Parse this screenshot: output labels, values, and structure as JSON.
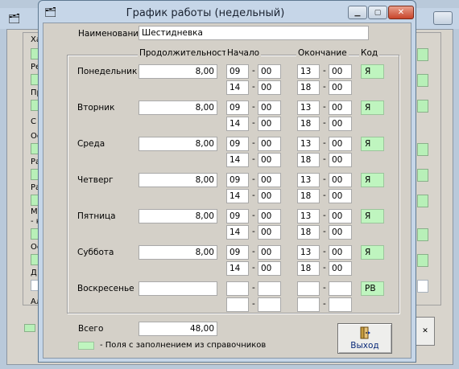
{
  "window": {
    "title": "График работы (недельный)",
    "controls": {
      "minimize": "▁",
      "maximize": "▢",
      "close": "✕"
    }
  },
  "name_field": {
    "label": "Наименование",
    "value": "Шестидневка"
  },
  "headers": {
    "duration": "Продолжительность",
    "start": "Начало",
    "end": "Окончание",
    "code": "Код"
  },
  "days": [
    {
      "label": "Понедельник",
      "duration": "8,00",
      "start1_h": "09",
      "start1_m": "00",
      "end1_h": "13",
      "end1_m": "00",
      "start2_h": "14",
      "start2_m": "00",
      "end2_h": "18",
      "end2_m": "00",
      "code": "Я"
    },
    {
      "label": "Вторник",
      "duration": "8,00",
      "start1_h": "09",
      "start1_m": "00",
      "end1_h": "13",
      "end1_m": "00",
      "start2_h": "14",
      "start2_m": "00",
      "end2_h": "18",
      "end2_m": "00",
      "code": "Я"
    },
    {
      "label": "Среда",
      "duration": "8,00",
      "start1_h": "09",
      "start1_m": "00",
      "end1_h": "13",
      "end1_m": "00",
      "start2_h": "14",
      "start2_m": "00",
      "end2_h": "18",
      "end2_m": "00",
      "code": "Я"
    },
    {
      "label": "Четверг",
      "duration": "8,00",
      "start1_h": "09",
      "start1_m": "00",
      "end1_h": "13",
      "end1_m": "00",
      "start2_h": "14",
      "start2_m": "00",
      "end2_h": "18",
      "end2_m": "00",
      "code": "Я"
    },
    {
      "label": "Пятница",
      "duration": "8,00",
      "start1_h": "09",
      "start1_m": "00",
      "end1_h": "13",
      "end1_m": "00",
      "start2_h": "14",
      "start2_m": "00",
      "end2_h": "18",
      "end2_m": "00",
      "code": "Я"
    },
    {
      "label": "Суббота",
      "duration": "8,00",
      "start1_h": "09",
      "start1_m": "00",
      "end1_h": "13",
      "end1_m": "00",
      "start2_h": "14",
      "start2_m": "00",
      "end2_h": "18",
      "end2_m": "00",
      "code": "Я"
    },
    {
      "label": "Воскресенье",
      "duration": "",
      "start1_h": "",
      "start1_m": "",
      "end1_h": "",
      "end1_m": "",
      "start2_h": "",
      "start2_m": "",
      "end2_h": "",
      "end2_m": "",
      "code": "РВ"
    }
  ],
  "dash": "-",
  "total": {
    "label": "Всего",
    "value": "48,00"
  },
  "legend": {
    "text": "- Поля с заполнением из справочников"
  },
  "exit_button": {
    "label": "Выход"
  },
  "background_window": {
    "labels": [
      "Ха",
      "Ре",
      "Пр",
      "С",
      "Ос",
      "Ра",
      "Ра",
      "М",
      "- н",
      "Ос",
      "Д",
      "Ал"
    ]
  },
  "colors": {
    "lookup_field": "#bff5bf",
    "dialog_frame": "#c6d6e8",
    "body": "#d4d0c8"
  }
}
